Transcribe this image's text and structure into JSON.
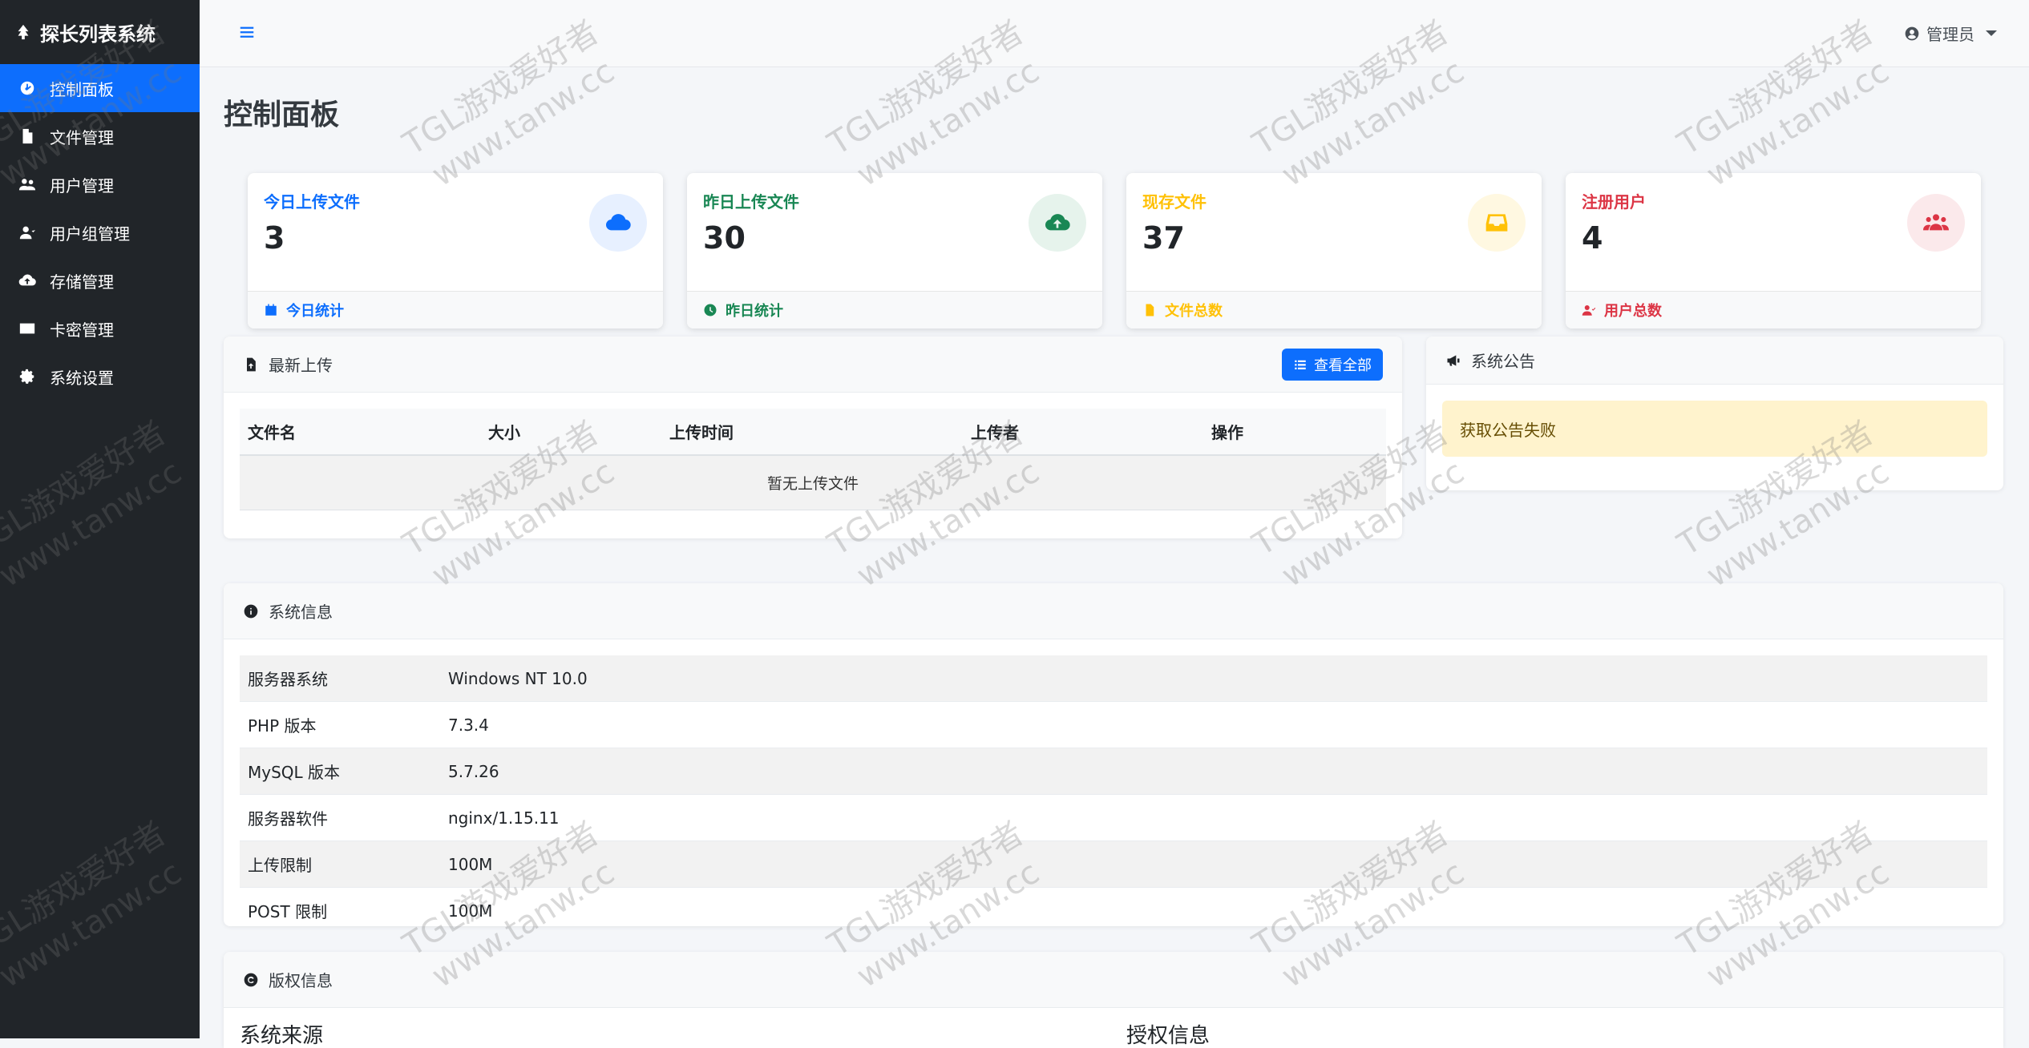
{
  "sidebar": {
    "brand": "探长列表系统",
    "items": [
      {
        "label": "控制面板",
        "active": true
      },
      {
        "label": "文件管理"
      },
      {
        "label": "用户管理"
      },
      {
        "label": "用户组管理"
      },
      {
        "label": "存储管理"
      },
      {
        "label": "卡密管理"
      },
      {
        "label": "系统设置"
      }
    ]
  },
  "topbar": {
    "user": "管理员"
  },
  "page": {
    "title": "控制面板"
  },
  "stats": [
    {
      "label": "今日上传文件",
      "value": "3",
      "footer": "今日统计",
      "color": "#0d6efd",
      "bg": "#e7f0ff",
      "icon": "cloud-icon"
    },
    {
      "label": "昨日上传文件",
      "value": "30",
      "footer": "昨日统计",
      "color": "#198754",
      "bg": "#e6f3ec",
      "icon": "cloud-upload-icon"
    },
    {
      "label": "现存文件",
      "value": "37",
      "footer": "文件总数",
      "color": "#ffc107",
      "bg": "#fff8e1",
      "icon": "inbox-icon"
    },
    {
      "label": "注册用户",
      "value": "4",
      "footer": "用户总数",
      "color": "#dc3545",
      "bg": "#fbe9eb",
      "icon": "users-icon"
    }
  ],
  "recent_uploads": {
    "title": "最新上传",
    "view_all": "查看全部",
    "columns": [
      "文件名",
      "大小",
      "上传时间",
      "上传者",
      "操作"
    ],
    "empty": "暂无上传文件"
  },
  "announcement": {
    "title": "系统公告",
    "message": "获取公告失败"
  },
  "system_info": {
    "title": "系统信息",
    "rows": [
      {
        "k": "服务器系统",
        "v": "Windows NT 10.0"
      },
      {
        "k": "PHP 版本",
        "v": "7.3.4"
      },
      {
        "k": "MySQL 版本",
        "v": "5.7.26"
      },
      {
        "k": "服务器软件",
        "v": "nginx/1.15.11"
      },
      {
        "k": "上传限制",
        "v": "100M"
      },
      {
        "k": "POST 限制",
        "v": "100M"
      }
    ]
  },
  "copyright": {
    "title": "版权信息",
    "source": "系统来源",
    "license": "授权信息"
  },
  "watermark": {
    "line1": "TGL游戏爱好者",
    "line2": "www.tanw.cc"
  }
}
